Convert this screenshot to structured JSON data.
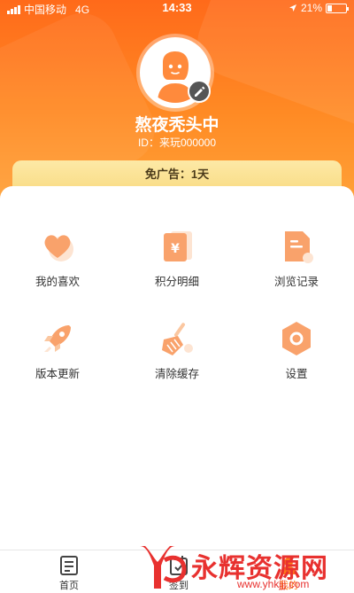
{
  "status_bar": {
    "carrier": "中国移动",
    "network": "4G",
    "time": "14:33",
    "battery": "21%"
  },
  "profile": {
    "nickname": "熬夜秃头中",
    "user_id": "ID：来玩000000",
    "ad_free": "免广告：1天"
  },
  "menu": [
    {
      "label": "我的喜欢",
      "icon": "heart-icon"
    },
    {
      "label": "积分明细",
      "icon": "points-icon"
    },
    {
      "label": "浏览记录",
      "icon": "history-icon"
    },
    {
      "label": "版本更新",
      "icon": "rocket-icon"
    },
    {
      "label": "清除缓存",
      "icon": "broom-icon"
    },
    {
      "label": "设置",
      "icon": "gear-icon"
    }
  ],
  "tabbar": [
    {
      "label": "首页",
      "icon": "home-list-icon"
    },
    {
      "label": "签到",
      "icon": "checkin-icon"
    },
    {
      "label": "我的",
      "icon": "profile-icon"
    }
  ],
  "watermark": {
    "brand": "永辉资源网",
    "url": "www.yhkjjj.com"
  },
  "colors": {
    "primary": "#ff7a1a",
    "accent_light": "#fbc7a0",
    "ad_banner": "#fbe29a",
    "watermark": "#e8312f"
  }
}
